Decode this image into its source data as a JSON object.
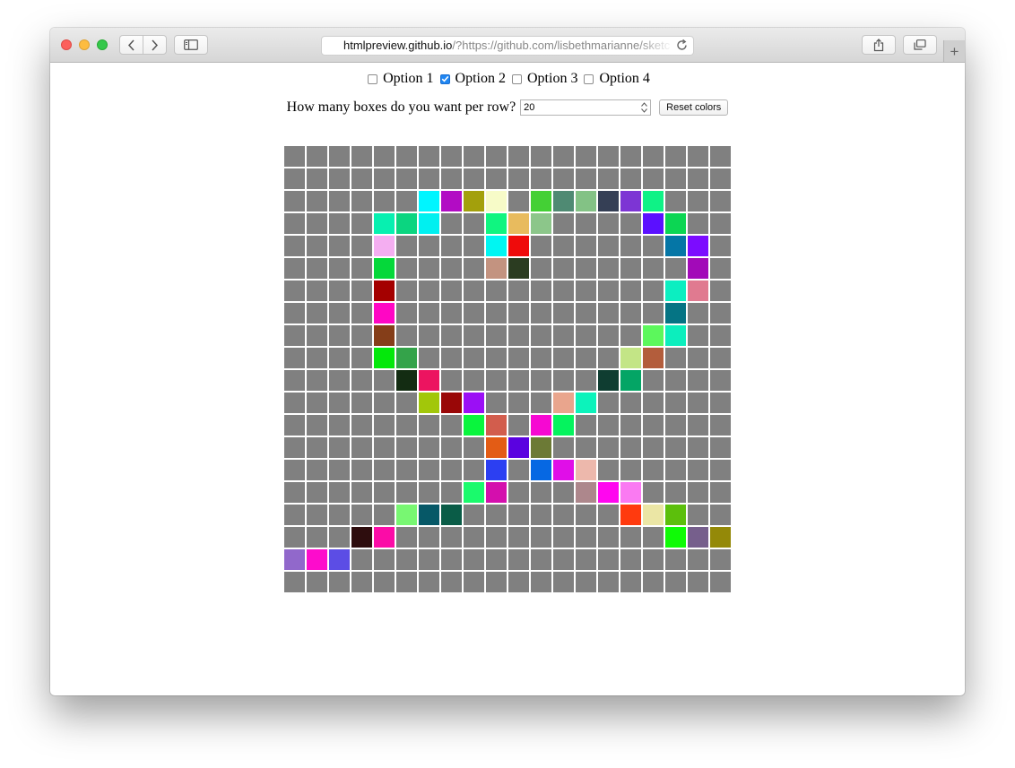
{
  "browser": {
    "url_host": "htmlpreview.github.io",
    "url_rest": "/?https://github.com/lisbethmarianne/sketc",
    "icons": {
      "back": "chevron-left-icon",
      "forward": "chevron-right-icon",
      "sidebar": "sidebar-icon",
      "share": "share-icon",
      "tabs": "tabs-overview-icon",
      "new_tab": "plus-icon",
      "reload": "reload-icon"
    },
    "traffic_lights": [
      "#fc605c",
      "#fdbc40",
      "#34c84a"
    ]
  },
  "options": [
    {
      "label": "Option 1",
      "checked": false
    },
    {
      "label": "Option 2",
      "checked": true
    },
    {
      "label": "Option 3",
      "checked": false
    },
    {
      "label": "Option 4",
      "checked": false
    }
  ],
  "boxes_prompt": "How many boxes do you want per row?",
  "boxes_value": "20",
  "reset_label": "Reset colors",
  "grid": {
    "columns": 20,
    "default_color": "#808080",
    "colored_cells": [
      {
        "row": 2,
        "col": 6,
        "color": "#00f5ff"
      },
      {
        "row": 2,
        "col": 7,
        "color": "#b20cc4"
      },
      {
        "row": 2,
        "col": 8,
        "color": "#a3a00c"
      },
      {
        "row": 2,
        "col": 9,
        "color": "#f7fbc8"
      },
      {
        "row": 2,
        "col": 11,
        "color": "#44d035"
      },
      {
        "row": 2,
        "col": 12,
        "color": "#4f8a73"
      },
      {
        "row": 2,
        "col": 13,
        "color": "#83c285"
      },
      {
        "row": 2,
        "col": 14,
        "color": "#353f55"
      },
      {
        "row": 2,
        "col": 15,
        "color": "#7d35d4"
      },
      {
        "row": 2,
        "col": 16,
        "color": "#0ff286"
      },
      {
        "row": 3,
        "col": 4,
        "color": "#07f0b0"
      },
      {
        "row": 3,
        "col": 5,
        "color": "#0bd580"
      },
      {
        "row": 3,
        "col": 6,
        "color": "#00f0f0"
      },
      {
        "row": 3,
        "col": 9,
        "color": "#10f580"
      },
      {
        "row": 3,
        "col": 10,
        "color": "#e8bb5e"
      },
      {
        "row": 3,
        "col": 11,
        "color": "#8cc68a"
      },
      {
        "row": 3,
        "col": 16,
        "color": "#5b10ff"
      },
      {
        "row": 3,
        "col": 17,
        "color": "#0cd653"
      },
      {
        "row": 4,
        "col": 4,
        "color": "#f4aef1"
      },
      {
        "row": 4,
        "col": 9,
        "color": "#00f6f2"
      },
      {
        "row": 4,
        "col": 10,
        "color": "#ef0b0b"
      },
      {
        "row": 4,
        "col": 17,
        "color": "#0576a6"
      },
      {
        "row": 4,
        "col": 18,
        "color": "#7c0cff"
      },
      {
        "row": 5,
        "col": 4,
        "color": "#05d83a"
      },
      {
        "row": 5,
        "col": 9,
        "color": "#c39380"
      },
      {
        "row": 5,
        "col": 10,
        "color": "#2b3c21"
      },
      {
        "row": 5,
        "col": 18,
        "color": "#a20ab8"
      },
      {
        "row": 6,
        "col": 4,
        "color": "#a40000"
      },
      {
        "row": 6,
        "col": 17,
        "color": "#0ceec1"
      },
      {
        "row": 6,
        "col": 18,
        "color": "#e07a90"
      },
      {
        "row": 7,
        "col": 4,
        "color": "#ff06c4"
      },
      {
        "row": 7,
        "col": 17,
        "color": "#057484"
      },
      {
        "row": 8,
        "col": 4,
        "color": "#853e19"
      },
      {
        "row": 8,
        "col": 16,
        "color": "#5cf75c"
      },
      {
        "row": 8,
        "col": 17,
        "color": "#0ceebd"
      },
      {
        "row": 9,
        "col": 4,
        "color": "#04e80b"
      },
      {
        "row": 9,
        "col": 5,
        "color": "#34a34a"
      },
      {
        "row": 9,
        "col": 15,
        "color": "#c3e586"
      },
      {
        "row": 9,
        "col": 16,
        "color": "#b35d3c"
      },
      {
        "row": 10,
        "col": 5,
        "color": "#132c12"
      },
      {
        "row": 10,
        "col": 6,
        "color": "#ec1460"
      },
      {
        "row": 10,
        "col": 14,
        "color": "#0f3d31"
      },
      {
        "row": 10,
        "col": 15,
        "color": "#04a565"
      },
      {
        "row": 11,
        "col": 6,
        "color": "#a2c70a"
      },
      {
        "row": 11,
        "col": 7,
        "color": "#990707"
      },
      {
        "row": 11,
        "col": 8,
        "color": "#9b0ff5"
      },
      {
        "row": 11,
        "col": 12,
        "color": "#e9a58d"
      },
      {
        "row": 11,
        "col": 13,
        "color": "#0cf3bb"
      },
      {
        "row": 12,
        "col": 8,
        "color": "#09f53d"
      },
      {
        "row": 12,
        "col": 9,
        "color": "#d25d4d"
      },
      {
        "row": 12,
        "col": 11,
        "color": "#f608d2"
      },
      {
        "row": 12,
        "col": 12,
        "color": "#05f35e"
      },
      {
        "row": 13,
        "col": 9,
        "color": "#e35c15"
      },
      {
        "row": 13,
        "col": 10,
        "color": "#5a02e0"
      },
      {
        "row": 13,
        "col": 11,
        "color": "#6c7a36"
      },
      {
        "row": 14,
        "col": 9,
        "color": "#2c3ff2"
      },
      {
        "row": 14,
        "col": 11,
        "color": "#0668e3"
      },
      {
        "row": 14,
        "col": 12,
        "color": "#e00ee8"
      },
      {
        "row": 14,
        "col": 13,
        "color": "#edb8ac"
      },
      {
        "row": 15,
        "col": 8,
        "color": "#1afa6c"
      },
      {
        "row": 15,
        "col": 9,
        "color": "#d40fad"
      },
      {
        "row": 15,
        "col": 13,
        "color": "#ad878c"
      },
      {
        "row": 15,
        "col": 14,
        "color": "#ff06ef"
      },
      {
        "row": 15,
        "col": 15,
        "color": "#fa7af2"
      },
      {
        "row": 16,
        "col": 5,
        "color": "#78f772"
      },
      {
        "row": 16,
        "col": 6,
        "color": "#065867"
      },
      {
        "row": 16,
        "col": 7,
        "color": "#0a5c47"
      },
      {
        "row": 16,
        "col": 15,
        "color": "#ff3a0e"
      },
      {
        "row": 16,
        "col": 16,
        "color": "#ebe6a5"
      },
      {
        "row": 16,
        "col": 17,
        "color": "#5cbf0c"
      },
      {
        "row": 17,
        "col": 3,
        "color": "#2e0d0e"
      },
      {
        "row": 17,
        "col": 4,
        "color": "#fb0ca7"
      },
      {
        "row": 17,
        "col": 17,
        "color": "#0ffb06"
      },
      {
        "row": 17,
        "col": 18,
        "color": "#765f8c"
      },
      {
        "row": 17,
        "col": 19,
        "color": "#948908"
      },
      {
        "row": 18,
        "col": 0,
        "color": "#9168cb"
      },
      {
        "row": 18,
        "col": 1,
        "color": "#fd0ccc"
      },
      {
        "row": 18,
        "col": 2,
        "color": "#5c4de5"
      }
    ]
  }
}
